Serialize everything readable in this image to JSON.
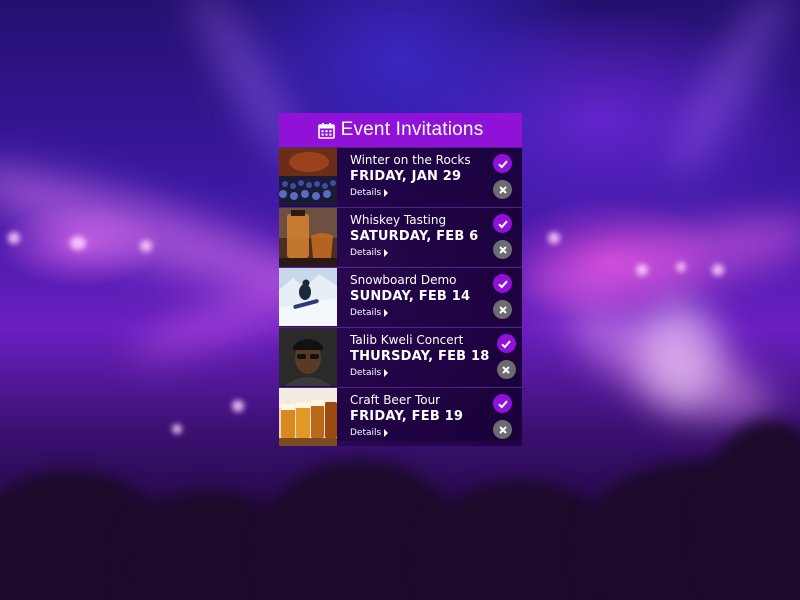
{
  "header": {
    "title": "Event Invitations",
    "icon": "calendar-icon"
  },
  "events": [
    {
      "name": "Winter on the Rocks",
      "date": "FRIDAY, JAN 29",
      "details_label": "Details",
      "image": "concert-crowd"
    },
    {
      "name": "Whiskey Tasting",
      "date": "SATURDAY, FEB 6",
      "details_label": "Details",
      "image": "whiskey-glasses"
    },
    {
      "name": "Snowboard Demo",
      "date": "SUNDAY, FEB 14",
      "details_label": "Details",
      "image": "snowboarder"
    },
    {
      "name": "Talib Kweli Concert",
      "date": "THURSDAY, FEB 18",
      "details_label": "Details",
      "image": "artist-portrait"
    },
    {
      "name": "Craft Beer Tour",
      "date": "FRIDAY, FEB 19",
      "details_label": "Details",
      "image": "beer-flight"
    }
  ],
  "colors": {
    "accent": "#9012d8",
    "decline": "#6b6b72",
    "text": "#ffffff"
  }
}
